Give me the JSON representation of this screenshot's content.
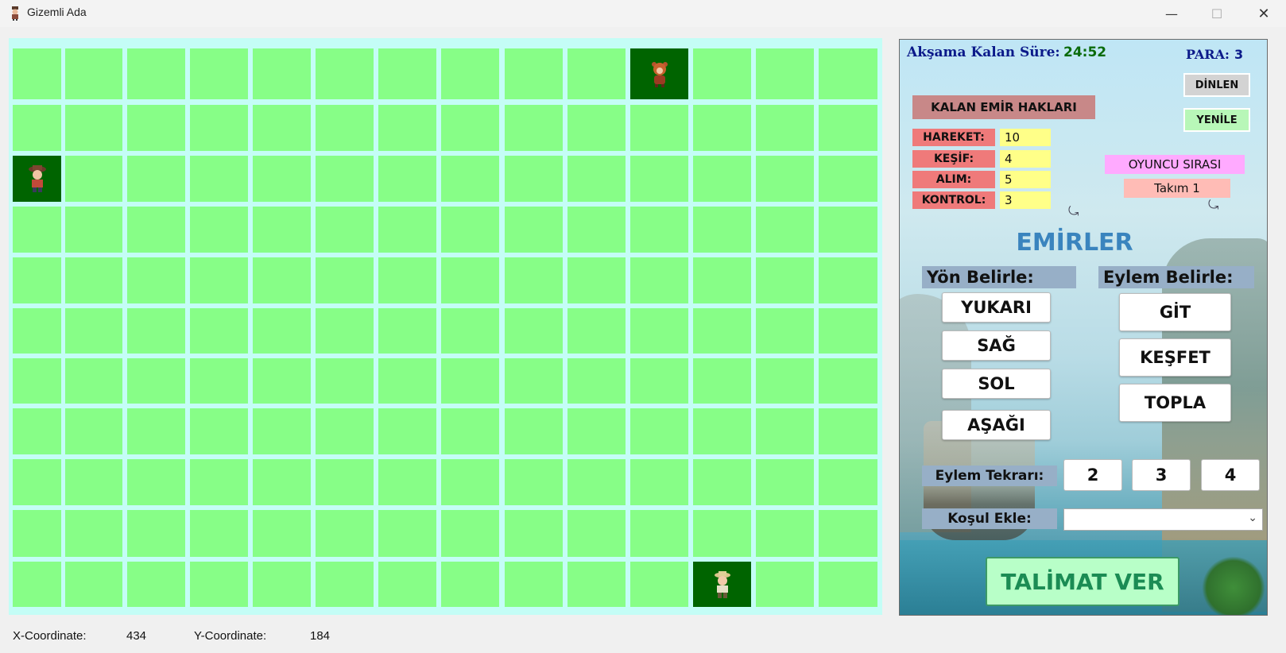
{
  "window": {
    "title": "Gizemli Ada",
    "icons": {
      "app": "pirate-character-icon",
      "minimize": "minimize-icon",
      "maximize": "maximize-icon",
      "close": "close-icon"
    }
  },
  "board": {
    "rows": 11,
    "cols": 14,
    "cell_color": "#87fe87",
    "occupied_color": "#006400",
    "grid_color": "#c4fdf6",
    "characters": [
      {
        "name": "bear-character",
        "row": 0,
        "col": 10
      },
      {
        "name": "pirate-girl-character",
        "row": 2,
        "col": 0
      },
      {
        "name": "explorer-character",
        "row": 10,
        "col": 11
      }
    ]
  },
  "status": {
    "x_label": "X-Coordinate:",
    "x_value": "434",
    "y_label": "Y-Coordinate:",
    "y_value": "184"
  },
  "panel": {
    "timer_label": "Akşama Kalan Süre:",
    "timer_value": "24:52",
    "para_label": "PARA:",
    "para_value": "3",
    "dinlen": "DİNLEN",
    "yenile": "YENİLE",
    "kalan_title": "KALAN EMİR HAKLARI",
    "stats": [
      {
        "label": "HAREKET:",
        "value": "10"
      },
      {
        "label": "KEŞİF:",
        "value": "4"
      },
      {
        "label": "ALIM:",
        "value": "5"
      },
      {
        "label": "KONTROL:",
        "value": "3"
      }
    ],
    "oyuncu_sirasi": "OYUNCU SIRASI",
    "takim": "Takım 1",
    "emirler": "EMİRLER",
    "yon_title": "Yön Belirle:",
    "yon_buttons": [
      "YUKARI",
      "SAĞ",
      "SOL",
      "AŞAĞI"
    ],
    "eylem_title": "Eylem Belirle:",
    "eylem_buttons": [
      "GİT",
      "KEŞFET",
      "TOPLA"
    ],
    "tekrar_label": "Eylem Tekrarı:",
    "tekrar_options": [
      "2",
      "3",
      "4"
    ],
    "kosul_label": "Koşul Ekle:",
    "kosul_value": "",
    "talimat": "TALİMAT VER"
  }
}
